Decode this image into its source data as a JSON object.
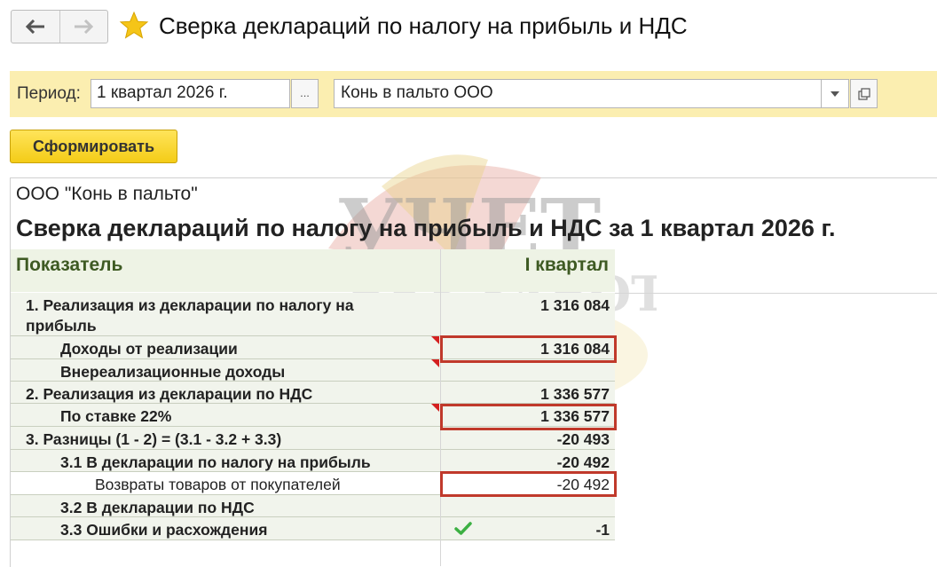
{
  "header": {
    "title": "Сверка деклараций по налогу на прибыль и НДС",
    "back_icon": "arrow-left-icon",
    "forward_icon": "arrow-right-icon",
    "favorite_icon": "star-icon"
  },
  "filters": {
    "period_label": "Период:",
    "period_value": "1 квартал 2026 г.",
    "period_choose_label": "...",
    "organization_value": "Конь в пальто ООО"
  },
  "actions": {
    "generate_label": "Сформировать"
  },
  "report": {
    "organization": "ООО \"Конь в пальто\"",
    "title": "Сверка деклараций по налогу на прибыль и НДС за 1 квартал 2026 г.",
    "columns": [
      "Показатель",
      "I квартал"
    ],
    "rows": [
      {
        "label": "1. Реализация из декларации по налогу на прибыль",
        "value": "1 316 084"
      },
      {
        "label": "Доходы от реализации",
        "value": "1 316 084"
      },
      {
        "label": "Внереализационные доходы",
        "value": ""
      },
      {
        "label": "2. Реализация из декларации по НДС",
        "value": "1 336 577"
      },
      {
        "label": "По ставке 22%",
        "value": "1 336 577"
      },
      {
        "label": "3. Разницы (1 - 2) = (3.1 - 3.2 + 3.3)",
        "value": "-20 493"
      },
      {
        "label": "3.1 В декларации по налогу на прибыль",
        "value": "-20 492"
      },
      {
        "label": "Возвраты товаров от покупателей",
        "value": "-20 492"
      },
      {
        "label": "3.2 В декларации по НДС",
        "value": ""
      },
      {
        "label": "3.3 Ошибки и расхождения",
        "value": "-1"
      }
    ]
  },
  "watermark": {
    "line1": "УЧЕТ",
    "line2": "БЕЗ ЗАБОТ"
  },
  "colors": {
    "accent_yellow": "#f4cc17",
    "filter_bar": "#fbeeb0",
    "header_green": "#3e5a23",
    "highlight_red": "#c0392b"
  }
}
